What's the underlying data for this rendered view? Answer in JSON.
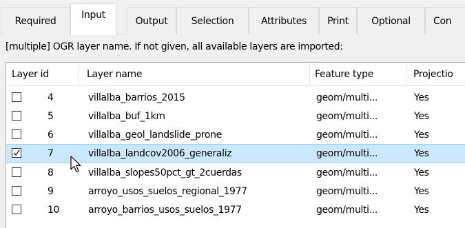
{
  "tabs": [
    {
      "label": "Required",
      "active": false
    },
    {
      "label": "Input",
      "active": true
    },
    {
      "label": "Output",
      "active": false
    },
    {
      "label": "Selection",
      "active": false
    },
    {
      "label": "Attributes",
      "active": false
    },
    {
      "label": "Print",
      "active": false
    },
    {
      "label": "Optional",
      "active": false
    },
    {
      "label": "Con",
      "active": false
    }
  ],
  "instruction": "[multiple] OGR layer name. If not given, all available layers are imported:",
  "table": {
    "columns": [
      "Layer id",
      "Layer name",
      "Feature type",
      "Projectio"
    ],
    "rows": [
      {
        "checked": false,
        "id": "4",
        "name": "villalba_barrios_2015",
        "type": "geom/multi...",
        "projection": "Yes"
      },
      {
        "checked": false,
        "id": "5",
        "name": "villalba_buf_1km",
        "type": "geom/multi...",
        "projection": "Yes"
      },
      {
        "checked": false,
        "id": "6",
        "name": "villalba_geol_landslide_prone",
        "type": "geom/multi...",
        "projection": "Yes"
      },
      {
        "checked": true,
        "id": "7",
        "name": "villalba_landcov2006_generaliz",
        "type": "geom/multi...",
        "projection": "Yes"
      },
      {
        "checked": false,
        "id": "8",
        "name": "villalba_slopes50pct_gt_2cuerdas",
        "type": "geom/multi...",
        "projection": "Yes"
      },
      {
        "checked": false,
        "id": "9",
        "name": "arroyo_usos_suelos_regional_1977",
        "type": "geom/multi...",
        "projection": "Yes"
      },
      {
        "checked": false,
        "id": "10",
        "name": "arroyo_barrios_usos_suelos_1977",
        "type": "geom/multi...",
        "projection": "Yes"
      }
    ]
  },
  "colors": {
    "selected_row": "#cce8ff",
    "selected_border": "#99d1ff",
    "window_bg": "#f0f0f0"
  },
  "icons": {
    "checkbox_checked": "check-mark",
    "cursor": "arrow-pointer"
  }
}
